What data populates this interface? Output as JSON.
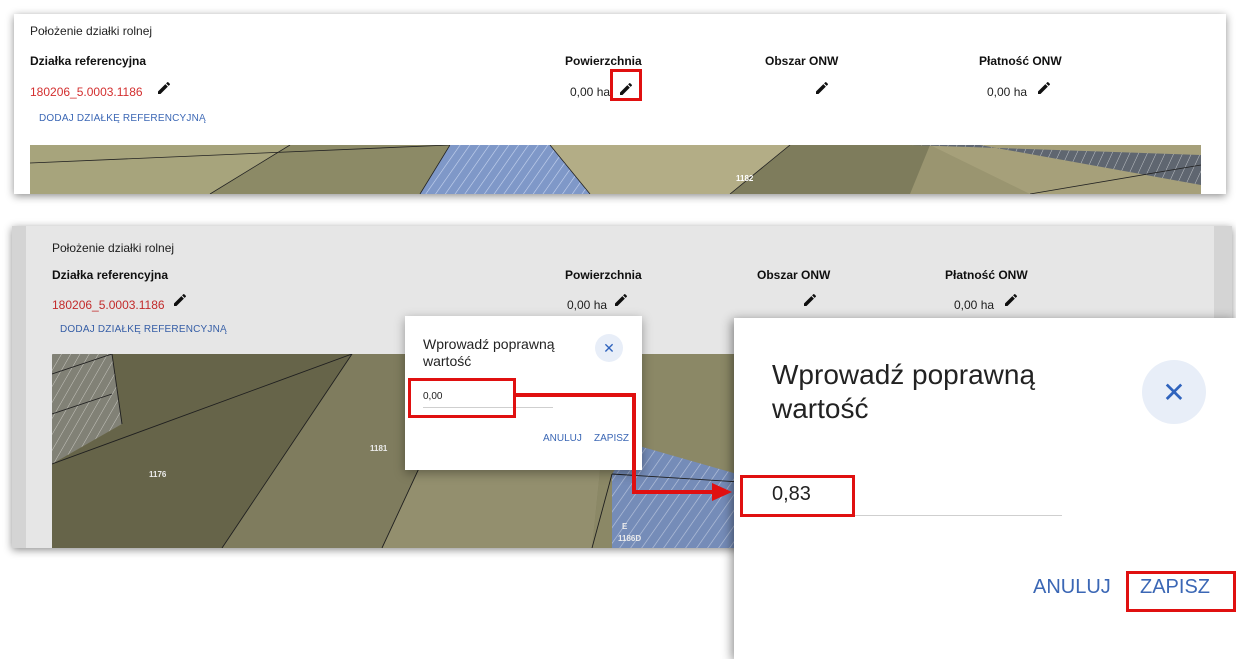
{
  "section_title": "Położenie działki rolnej",
  "columns": {
    "ref": "Działka referencyjna",
    "area": "Powierzchnia",
    "onw_area": "Obszar ONW",
    "onw_payment": "Płatność ONW"
  },
  "row": {
    "ref_id": "180206_5.0003.1186",
    "area": "0,00 ha",
    "onw_payment": "0,00 ha"
  },
  "add_ref_link": "DODAJ DZIAŁKĘ REFERENCYJNĄ",
  "map_labels": {
    "top": "1182",
    "bottom_left": "1176",
    "bottom_mid": "1181",
    "bottom_right_letter": "E",
    "bottom_right_code": "1186D"
  },
  "dialog": {
    "title": "Wprowadź poprawną wartość",
    "value_initial": "0,00",
    "value_corrected": "0,83",
    "cancel_label": "ANULUJ",
    "save_label": "ZAPISZ",
    "close_icon_glyph": "✕"
  },
  "colors": {
    "ref_link": "#d32f2f",
    "action_blue": "#3b67b5",
    "highlight_red": "#e01010",
    "close_bg": "#e8eef8"
  },
  "icons": [
    "pencil-icon",
    "close-icon",
    "arrow-icon"
  ]
}
